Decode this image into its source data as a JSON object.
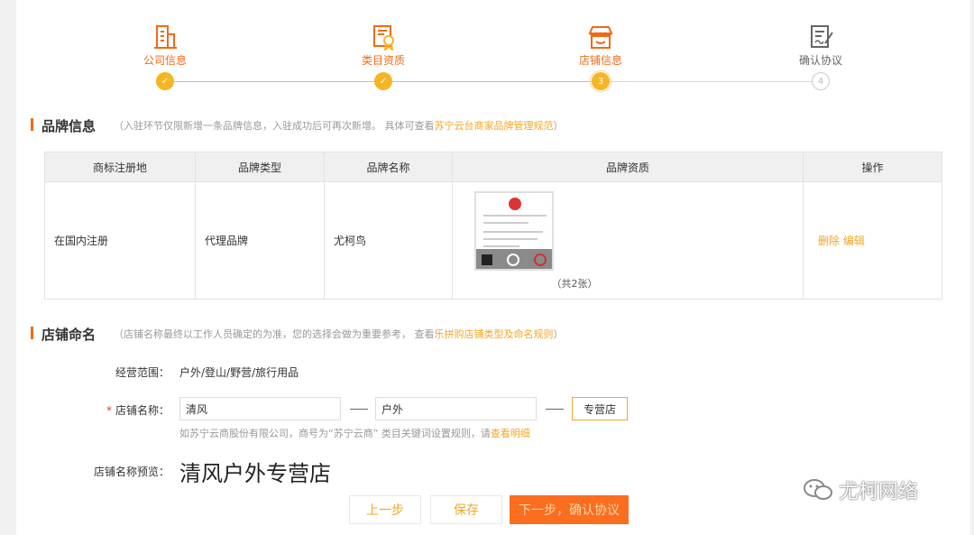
{
  "steps": [
    {
      "label": "公司信息",
      "state": "done",
      "icon": "building-icon"
    },
    {
      "label": "类目资质",
      "state": "done",
      "icon": "certificate-icon"
    },
    {
      "label": "店铺信息",
      "state": "active",
      "number": "3",
      "icon": "store-icon"
    },
    {
      "label": "确认协议",
      "state": "todo",
      "number": "4",
      "icon": "agreement-icon"
    }
  ],
  "brand_section": {
    "title": "品牌信息",
    "note_prefix": "（入驻环节仅限新增一条品牌信息，入驻成功后可再次新增。  具体可查看",
    "note_link": "苏宁云台商家品牌管理规范",
    "note_suffix": "）"
  },
  "brand_table": {
    "headers": [
      "商标注册地",
      "品牌类型",
      "品牌名称",
      "品牌资质",
      "操作"
    ],
    "rows": [
      {
        "registration": "在国内注册",
        "type": "代理品牌",
        "name": "尤柯鸟",
        "qualification_count": "（共2张）",
        "delete": "删除",
        "edit": "编辑"
      }
    ]
  },
  "store_section": {
    "title": "店铺命名",
    "note_prefix": "（店铺名称最终以工作人员确定的为准，您的选择会做为重要参考，  查看",
    "note_link": "乐拼购店铺类型及命名规则",
    "note_suffix": "）"
  },
  "form": {
    "scope_label": "经营范围：",
    "scope_value": "户外/登山/野营/旅行用品",
    "name_label": "店铺名称：",
    "name_required": "*",
    "name_part1": "清风",
    "name_part2": "户外",
    "name_suffix": "专营店",
    "hint_prefix": "如苏宁云商股份有限公司，商号为“苏宁云商”  类目关键词设置规则，请",
    "hint_link": "查看明细",
    "preview_label": "店铺名称预览：",
    "preview_value": "清风户外专营店"
  },
  "buttons": {
    "prev": "上一步",
    "save": "保存",
    "next": "下一步，确认协议"
  },
  "watermark": "尤柯网络",
  "colors": {
    "accent": "#f06a16",
    "link": "#f5a623",
    "primary_button": "#fb6d1f",
    "done_dot": "#f5b625"
  }
}
